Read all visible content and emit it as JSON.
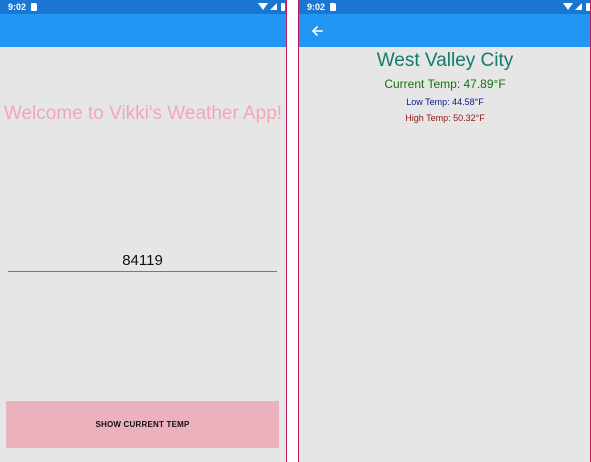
{
  "colors": {
    "status_bar": "#1976d2",
    "app_bar": "#2196f3",
    "page_background": "#e6e6e6",
    "welcome_text": "#f4a6b6",
    "button_background": "#ebb2be",
    "city_text": "#137a6f",
    "current_temp_text": "#15720f",
    "low_temp_text": "#0a1a8c",
    "high_temp_text": "#8c1616"
  },
  "left_screen": {
    "status_bar": {
      "time": "9:02",
      "icons": [
        "sd-card-icon",
        "wifi-icon",
        "signal-icon",
        "battery-icon"
      ]
    },
    "welcome_text": "Welcome to Vikki's Weather App!",
    "zip_input": {
      "value": "84119"
    },
    "show_button_label": "SHOW CURRENT TEMP"
  },
  "right_screen": {
    "status_bar": {
      "time": "9:02",
      "icons": [
        "sd-card-icon",
        "wifi-icon",
        "signal-icon",
        "battery-icon"
      ]
    },
    "app_bar": {
      "icon": "back-arrow-icon"
    },
    "city": "West Valley City",
    "current_temp": "Current Temp: 47.89°F",
    "low_temp": "Low Temp: 44.58°F",
    "high_temp": "High Temp: 50.32°F"
  }
}
